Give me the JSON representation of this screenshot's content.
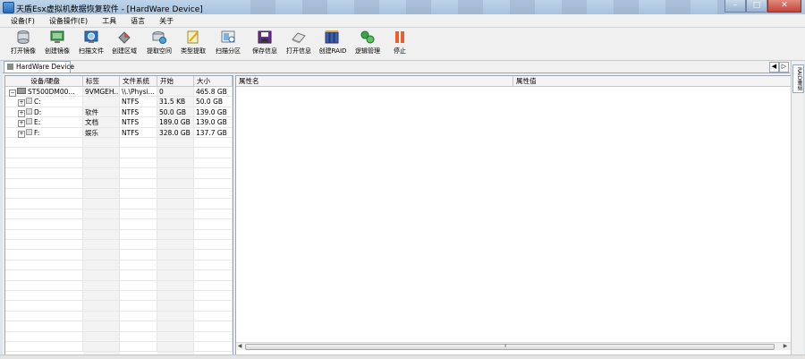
{
  "window": {
    "title": "天盾Esx虚拟机数据恢复软件 - [HardWare Device]",
    "controls": {
      "minimize": "–",
      "maximize": "□",
      "close": "✕"
    }
  },
  "menu": [
    "设备(F)",
    "设备操作(E)",
    "工具",
    "语言",
    "关于"
  ],
  "toolbar": [
    {
      "label": "打开镜像",
      "icon": "open-image-icon"
    },
    {
      "label": "创建镜像",
      "icon": "create-image-icon"
    },
    {
      "label": "扫描文件",
      "icon": "scan-files-icon"
    },
    {
      "label": "创建区域",
      "icon": "create-region-icon"
    },
    {
      "label": "提取空间",
      "icon": "extract-space-icon"
    },
    {
      "label": "类型提取",
      "icon": "type-extract-icon"
    },
    {
      "label": "扫描分区",
      "icon": "scan-partition-icon"
    },
    {
      "label": "保存信息",
      "icon": "save-info-icon"
    },
    {
      "label": "打开信息",
      "icon": "open-info-icon"
    },
    {
      "label": "创建RAID",
      "icon": "create-raid-icon"
    },
    {
      "label": "逻辑管理",
      "icon": "logic-manage-icon"
    },
    {
      "label": "停止",
      "icon": "stop-icon"
    }
  ],
  "tabs": {
    "active": "HardWare Device",
    "nav_left": "◀",
    "nav_right": "▷"
  },
  "device_table": {
    "columns": [
      "设备/硬盘",
      "标签",
      "文件系统",
      "开始",
      "大小"
    ],
    "rows": [
      {
        "name": "ST500DM00...",
        "label": "9VMGEH...",
        "fs": "\\\\.\\Physi...",
        "start": "0",
        "size": "465.8 GB",
        "type": "disk"
      },
      {
        "name": "C:",
        "label": "",
        "fs": "NTFS",
        "start": "31.5 KB",
        "size": "50.0 GB",
        "type": "volume"
      },
      {
        "name": "D:",
        "label": "软件",
        "fs": "NTFS",
        "start": "50.0 GB",
        "size": "139.0 GB",
        "type": "volume"
      },
      {
        "name": "E:",
        "label": "文档",
        "fs": "NTFS",
        "start": "189.0 GB",
        "size": "139.0 GB",
        "type": "volume"
      },
      {
        "name": "F:",
        "label": "娱乐",
        "fs": "NTFS",
        "start": "328.0 GB",
        "size": "137.7 GB",
        "type": "volume"
      }
    ]
  },
  "property_table": {
    "columns": [
      "属性名",
      "属性值"
    ]
  },
  "side_panel": {
    "tab": "RAID重组"
  },
  "colors": {
    "title_bar": "#bcd3ea",
    "close_button": "#c3443a",
    "stop_icon": "#e8602c",
    "accent": "#2a6bb6"
  }
}
